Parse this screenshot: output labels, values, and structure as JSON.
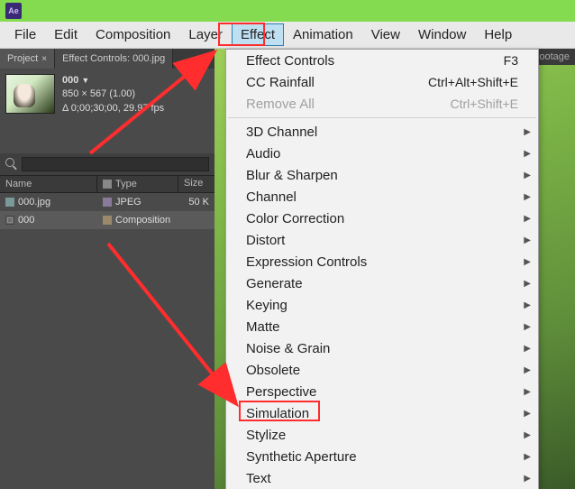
{
  "app": {
    "icon_text": "Ae"
  },
  "menubar": {
    "items": [
      "File",
      "Edit",
      "Composition",
      "Layer",
      "Effect",
      "Animation",
      "View",
      "Window",
      "Help"
    ],
    "active_index": 4
  },
  "panel_tabs": {
    "project": "Project",
    "effect_controls": "Effect Controls: 000.jpg"
  },
  "project_item": {
    "name": "000",
    "dimensions": "850 × 567 (1.00)",
    "duration": "Δ 0;00;30;00, 29.97 fps"
  },
  "list_headers": {
    "name": "Name",
    "type": "Type",
    "size": "Size"
  },
  "project_rows": [
    {
      "name": "000.jpg",
      "type": "JPEG",
      "size": "50 K",
      "kind": "image"
    },
    {
      "name": "000",
      "type": "Composition",
      "size": "",
      "kind": "comp"
    }
  ],
  "footage_tab": "ootage",
  "dropdown": {
    "top": [
      {
        "label": "Effect Controls",
        "shortcut": "F3"
      },
      {
        "label": "CC Rainfall",
        "shortcut": "Ctrl+Alt+Shift+E"
      },
      {
        "label": "Remove All",
        "shortcut": "Ctrl+Shift+E",
        "disabled": true
      }
    ],
    "subs": [
      "3D Channel",
      "Audio",
      "Blur & Sharpen",
      "Channel",
      "Color Correction",
      "Distort",
      "Expression Controls",
      "Generate",
      "Keying",
      "Matte",
      "Noise & Grain",
      "Obsolete",
      "Perspective",
      "Simulation",
      "Stylize",
      "Synthetic Aperture",
      "Text"
    ],
    "highlighted_sub": "Simulation"
  }
}
